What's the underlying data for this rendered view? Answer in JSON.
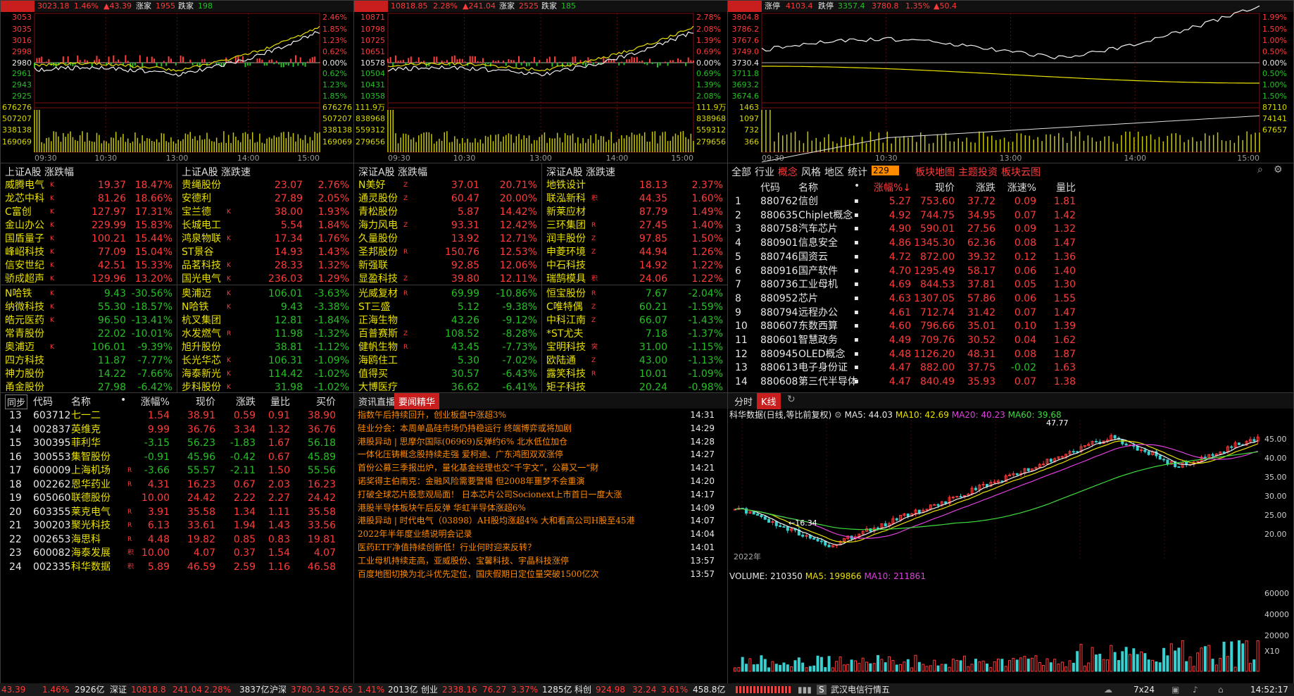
{
  "mini": [
    {
      "hdr_val": "3023.18",
      "hdr_pct": "1.46%",
      "hdr_chg": "▲43.39",
      "up_lbl": "涨家",
      "up_n": "1955",
      "dn_lbl": "跌家",
      "dn_n": "198",
      "lt": [
        "3053",
        "3035",
        "3016",
        "2998",
        "2980",
        "2961",
        "2943",
        "2925",
        "676276",
        "507207",
        "338138",
        "169069"
      ],
      "rt": [
        "2.46%",
        "1.85%",
        "1.23%",
        "0.62%",
        "0.00%",
        "0.62%",
        "1.23%",
        "1.85%",
        "676276",
        "507207",
        "338138",
        "169069"
      ],
      "tm": [
        "09:30",
        "10:30",
        "13:00",
        "14:00",
        "15:00"
      ]
    },
    {
      "hdr_val": "10818.85",
      "hdr_pct": "2.28%",
      "hdr_chg": "▲241.04",
      "up_lbl": "涨家",
      "up_n": "2525",
      "dn_lbl": "跌家",
      "dn_n": "185",
      "lt": [
        "10871",
        "10798",
        "10725",
        "10651",
        "10578",
        "10504",
        "10431",
        "10358",
        "111.9万",
        "838968",
        "559312",
        "279656"
      ],
      "rt": [
        "2.78%",
        "2.08%",
        "1.39%",
        "0.69%",
        "0.00%",
        "0.69%",
        "1.39%",
        "2.08%",
        "111.9万",
        "838968",
        "559312",
        "279656"
      ],
      "tm": [
        "09:30",
        "10:30",
        "13:00",
        "14:00",
        "15:00"
      ]
    },
    {
      "hdr_val": "",
      "hdr_pct": "1.35%",
      "hdr_chg": "▲50.4",
      "up_lbl": "涨停",
      "up_n": "4103.4",
      "dn_lbl": "跌停",
      "dn_n": "3357.4",
      "mid": "3780.8",
      "lt": [
        "3804.8",
        "3786.2",
        "3767.6",
        "3749.0",
        "3730.4",
        "3711.8",
        "3693.2",
        "3674.6",
        "1463",
        "1097",
        "732",
        "366"
      ],
      "rt": [
        "1.99%",
        "1.50%",
        "1.00%",
        "0.50%",
        "0.00%",
        "0.50%",
        "1.00%",
        "1.50%",
        "87110",
        "74141",
        "67657",
        ""
      ],
      "tm": [
        "09:30",
        "10:30",
        "13:00",
        "14:00",
        "15:00"
      ]
    }
  ],
  "lists": [
    {
      "title": "上证A股 涨跌幅",
      "rows": [
        [
          "威腾电气",
          "K",
          "19.37",
          "18.47%"
        ],
        [
          "龙芯中科",
          "K",
          "81.26",
          "18.66%"
        ],
        [
          "C富创",
          "K",
          "127.97",
          "17.31%"
        ],
        [
          "金山办公",
          "K",
          "229.99",
          "15.83%"
        ],
        [
          "国盾量子",
          "K",
          "100.21",
          "15.44%"
        ],
        [
          "峰岹科技",
          "K",
          "77.09",
          "15.04%"
        ],
        [
          "信安世纪",
          "K",
          "42.51",
          "15.33%"
        ],
        [
          "骄成超声",
          "K",
          "129.96",
          "13.20%"
        ],
        [
          "N哈铁",
          "K",
          "9.43",
          "-30.56%"
        ],
        [
          "纳微科技",
          "K",
          "55.30",
          "-18.57%"
        ],
        [
          "皓元医药",
          "K",
          "96.50",
          "-13.41%"
        ],
        [
          "常青股份",
          "",
          "22.02",
          "-10.01%"
        ],
        [
          "奥浦迈",
          "K",
          "106.01",
          "-9.39%"
        ],
        [
          "四方科技",
          "",
          "11.87",
          "-7.77%"
        ],
        [
          "神力股份",
          "",
          "14.22",
          "-7.66%"
        ],
        [
          "甬金股份",
          "",
          "27.98",
          "-6.42%"
        ]
      ]
    },
    {
      "title": "上证A股 涨跌速",
      "rows": [
        [
          "贵绳股份",
          "",
          "23.07",
          "2.76%"
        ],
        [
          "安德利",
          "",
          "27.89",
          "2.05%"
        ],
        [
          "宝兰德",
          "K",
          "38.00",
          "1.93%"
        ],
        [
          "长城电工",
          "",
          "5.54",
          "1.84%"
        ],
        [
          "鸿泉物联",
          "K",
          "17.34",
          "1.76%"
        ],
        [
          "ST景谷",
          "",
          "14.93",
          "1.43%"
        ],
        [
          "品茗科技",
          "K",
          "28.33",
          "1.32%"
        ],
        [
          "国光电气",
          "K",
          "236.03",
          "1.29%"
        ],
        [
          "奥浦迈",
          "K",
          "106.01",
          "-3.63%"
        ],
        [
          "N哈铁",
          "K",
          "9.43",
          "-3.38%"
        ],
        [
          "杭叉集团",
          "",
          "12.81",
          "-1.84%"
        ],
        [
          "水发燃气",
          "R",
          "11.98",
          "-1.32%"
        ],
        [
          "旭升股份",
          "",
          "38.81",
          "-1.12%"
        ],
        [
          "长光华芯",
          "K",
          "106.31",
          "-1.09%"
        ],
        [
          "海泰新光",
          "K",
          "114.42",
          "-1.02%"
        ],
        [
          "步科股份",
          "K",
          "31.98",
          "-1.02%"
        ]
      ]
    },
    {
      "title": "深证A股 涨跌幅",
      "rows": [
        [
          "N美好",
          "Z",
          "37.01",
          "20.71%"
        ],
        [
          "通灵股份",
          "Z",
          "60.47",
          "20.00%"
        ],
        [
          "青松股份",
          "",
          "5.87",
          "14.42%"
        ],
        [
          "海力风电",
          "Z",
          "93.31",
          "12.42%"
        ],
        [
          "久量股份",
          "",
          "13.92",
          "12.71%"
        ],
        [
          "圣邦股份",
          "R",
          "150.76",
          "12.53%"
        ],
        [
          "新强联",
          "",
          "92.85",
          "12.06%"
        ],
        [
          "显盈科技",
          "Z",
          "39.80",
          "12.11%"
        ],
        [
          "光威复材",
          "R",
          "69.99",
          "-10.86%"
        ],
        [
          "ST三盛",
          "",
          "5.12",
          "-9.38%"
        ],
        [
          "正海生物",
          "",
          "43.26",
          "-9.12%"
        ],
        [
          "百普赛斯",
          "Z",
          "108.52",
          "-8.28%"
        ],
        [
          "健帆生物",
          "R",
          "43.45",
          "-7.73%"
        ],
        [
          "海鸥住工",
          "",
          "5.30",
          "-7.02%"
        ],
        [
          "值得买",
          "",
          "30.57",
          "-6.43%"
        ],
        [
          "大博医疗",
          "",
          "36.62",
          "-6.41%"
        ]
      ]
    },
    {
      "title": "深证A股 涨跌速",
      "rows": [
        [
          "地铁设计",
          "",
          "18.13",
          "2.37%"
        ],
        [
          "联泓新科",
          "积",
          "44.35",
          "1.60%"
        ],
        [
          "新莱应材",
          "",
          "87.79",
          "1.49%"
        ],
        [
          "三环集团",
          "R",
          "27.45",
          "1.40%"
        ],
        [
          "润丰股份",
          "Z",
          "97.85",
          "1.50%"
        ],
        [
          "申菱环境",
          "Z",
          "44.94",
          "1.26%"
        ],
        [
          "中石科技",
          "",
          "14.92",
          "1.22%"
        ],
        [
          "瑞鹄模具",
          "积",
          "24.06",
          "1.22%"
        ],
        [
          "恒宝股份",
          "R",
          "7.67",
          "-2.04%"
        ],
        [
          "C唯特偶",
          "Z",
          "60.21",
          "-1.59%"
        ],
        [
          "中科江南",
          "Z",
          "66.07",
          "-1.43%"
        ],
        [
          "*ST尤夫",
          "",
          "7.18",
          "-1.37%"
        ],
        [
          "宝明科技",
          "突",
          "31.00",
          "-1.15%"
        ],
        [
          "欧陆通",
          "Z",
          "43.00",
          "-1.13%"
        ],
        [
          "露笑科技",
          "R",
          "10.01",
          "-1.09%"
        ],
        [
          "矩子科技",
          "",
          "20.24",
          "-0.98%"
        ]
      ]
    }
  ],
  "concept": {
    "tabs": [
      "全部",
      "行业",
      "概念",
      "风格",
      "地区",
      "统计"
    ],
    "badge": "229",
    "links": [
      "板块地图",
      "主题投资",
      "板块云图"
    ],
    "cols": [
      "代码",
      "名称",
      "•",
      "涨幅%↓",
      "现价",
      "涨跌",
      "涨速%",
      "量比"
    ],
    "rows": [
      [
        "1",
        "880762",
        "信创",
        "5.27",
        "753.60",
        "37.72",
        "0.09",
        "1.81"
      ],
      [
        "2",
        "880635",
        "Chiplet概念",
        "4.92",
        "744.75",
        "34.95",
        "0.07",
        "1.42"
      ],
      [
        "3",
        "880758",
        "汽车芯片",
        "4.90",
        "590.01",
        "27.56",
        "0.09",
        "1.32"
      ],
      [
        "4",
        "880901",
        "信息安全",
        "4.86",
        "1345.30",
        "62.36",
        "0.08",
        "1.47"
      ],
      [
        "5",
        "880746",
        "国资云",
        "4.72",
        "872.00",
        "39.32",
        "0.12",
        "1.36"
      ],
      [
        "6",
        "880916",
        "国产软件",
        "4.70",
        "1295.49",
        "58.17",
        "0.06",
        "1.40"
      ],
      [
        "7",
        "880736",
        "工业母机",
        "4.69",
        "844.53",
        "37.81",
        "0.05",
        "1.30"
      ],
      [
        "8",
        "880952",
        "芯片",
        "4.63",
        "1307.05",
        "57.86",
        "0.06",
        "1.55"
      ],
      [
        "9",
        "880794",
        "远程办公",
        "4.61",
        "712.74",
        "31.42",
        "0.07",
        "1.47"
      ],
      [
        "10",
        "880607",
        "东数西算",
        "4.60",
        "796.66",
        "35.01",
        "0.10",
        "1.39"
      ],
      [
        "11",
        "880601",
        "智慧政务",
        "4.49",
        "709.76",
        "30.52",
        "0.04",
        "1.62"
      ],
      [
        "12",
        "880945",
        "OLED概念",
        "4.48",
        "1126.20",
        "48.31",
        "0.08",
        "1.87"
      ],
      [
        "13",
        "880613",
        "电子身份证",
        "4.47",
        "882.00",
        "37.75",
        "-0.02",
        "1.63"
      ],
      [
        "14",
        "880608",
        "第三代半导体",
        "4.47",
        "840.49",
        "35.93",
        "0.07",
        "1.38"
      ]
    ]
  },
  "stocks": {
    "sync": "同步",
    "cols": [
      "代码",
      "名称",
      "•",
      "涨幅%",
      "现价",
      "涨跌",
      "量比",
      "买价"
    ],
    "rows": [
      [
        "13",
        "603712",
        "七一二",
        "",
        "1.54",
        "38.91",
        "0.59",
        "0.91",
        "38.90"
      ],
      [
        "14",
        "002837",
        "英维克",
        "",
        "9.99",
        "36.76",
        "3.34",
        "1.32",
        "36.76"
      ],
      [
        "15",
        "300395",
        "菲利华",
        "",
        "-3.15",
        "56.23",
        "-1.83",
        "1.67",
        "56.18"
      ],
      [
        "16",
        "300553",
        "集智股份",
        "",
        "-0.91",
        "45.96",
        "-0.42",
        "0.67",
        "45.89"
      ],
      [
        "17",
        "600009",
        "上海机场",
        "R",
        "-3.66",
        "55.57",
        "-2.11",
        "1.50",
        "55.56"
      ],
      [
        "18",
        "002262",
        "恩华药业",
        "R",
        "4.31",
        "16.23",
        "0.67",
        "2.03",
        "16.23"
      ],
      [
        "19",
        "605060",
        "联德股份",
        "",
        "10.00",
        "24.42",
        "2.22",
        "2.27",
        "24.42"
      ],
      [
        "20",
        "603355",
        "莱克电气",
        "R",
        "3.91",
        "35.58",
        "1.34",
        "1.11",
        "35.58"
      ],
      [
        "21",
        "300203",
        "聚光科技",
        "R",
        "6.13",
        "33.61",
        "1.94",
        "1.43",
        "33.56"
      ],
      [
        "22",
        "002653",
        "海思科",
        "R",
        "4.48",
        "19.82",
        "0.85",
        "0.83",
        "19.81"
      ],
      [
        "23",
        "600082",
        "海泰发展",
        "积",
        "10.00",
        "4.07",
        "0.37",
        "1.54",
        "4.07"
      ],
      [
        "24",
        "002335",
        "科华数据",
        "积",
        "5.89",
        "46.59",
        "2.59",
        "1.16",
        "46.58"
      ]
    ]
  },
  "news": {
    "tabs": [
      "资讯直播",
      "要闻精华"
    ],
    "items": [
      [
        "指数午后持续回升，创业板盘中涨超3%",
        "14:31"
      ],
      [
        "硅业分会：本周单晶硅市场仍持稳运行 终端博弈或将加剧",
        "14:29"
      ],
      [
        "港股异动 | 思摩尔国际(06969)反弹约6% 北水低位加仓",
        "14:28"
      ],
      [
        "一体化压铸概念股持续走强 爱柯迪、广东鸿图双双涨停",
        "14:27"
      ],
      [
        "首份公募三季报出炉，量化基金经理也交“千字文”，公募又一“財",
        "14:21"
      ],
      [
        "诺奖得主伯南克：金融风险需要警惕 但2008年噩梦不会重演",
        "14:20"
      ],
      [
        "打破全球芯片股悲观局面！ 日本芯片公司Socionext上市首日一度大涨",
        "14:17"
      ],
      [
        "港股半导体板块午后反弹 华虹半导体涨超6%",
        "14:09"
      ],
      [
        "港股异动 | 时代电气（03898）AH股均涨超4% 大和看高公司H股至45港",
        "14:07"
      ],
      [
        "2022年半年度业绩说明会记录",
        "14:04"
      ],
      [
        "医药ETF净值持续创新低！行业何时迎来反转？",
        "14:01"
      ],
      [
        "工业母机持续走高，亚威股份、宝馨科技、宇晶科技涨停",
        "13:57"
      ],
      [
        "百度地图切换为北斗优先定位，国庆假期日定位量突破1500亿次",
        "13:57"
      ]
    ]
  },
  "kline": {
    "tabs": [
      "分时",
      "K线"
    ],
    "title": "科华数据(日线,等比前复权)",
    "ma5": "MA5: 44.03",
    "ma10": "MA10: 42.69",
    "ma20": "MA20: 40.23",
    "ma60": "MA60: 39.68",
    "hi": "47.77",
    "lo": "16.34",
    "yr": "2022年",
    "yticks": [
      "45.00",
      "40.00",
      "35.00",
      "30.00",
      "25.00",
      "20.00"
    ],
    "vol": "VOLUME: 210350",
    "vma5": "MA5: 199866",
    "vma10": "MA10: 211861",
    "vticks": [
      "60000",
      "40000",
      "20000",
      "X10"
    ]
  },
  "status": {
    "sh_chg": "43.39",
    "sh_pct": "1.46%",
    "sh_amt": "2926亿",
    "sz_lbl": "深证",
    "sz_val": "10818.8",
    "sz_chg": "241.04",
    "sz_pct": "2.28%",
    "sz_amt": "3837亿",
    "hs_lbl": "沪深",
    "hs_val": "3780.34",
    "hs_chg": "52.65",
    "hs_pct": "1.41%",
    "hs_amt": "2013亿",
    "cy_lbl": "创业",
    "cy_val": "2338.16",
    "cy_chg": "76.27",
    "cy_pct": "3.37%",
    "cy_amt": "1285亿",
    "kc_lbl": "科创",
    "kc_val": "924.98",
    "kc_chg": "32.24",
    "kc_pct": "3.61%",
    "kc_amt": "458.8亿",
    "ticker": "武汉电信行情五",
    "mode": "7x24",
    "time": "14:52:17",
    "s": "S"
  }
}
